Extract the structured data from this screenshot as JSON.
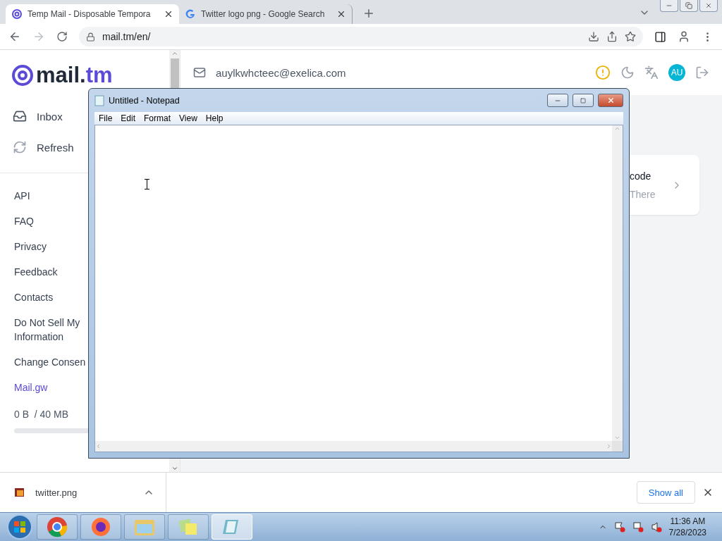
{
  "browser": {
    "tabs": [
      {
        "title": "Temp Mail - Disposable Tempora",
        "selected": true
      },
      {
        "title": "Twitter logo png - Google Search",
        "selected": false
      }
    ],
    "address": "mail.tm/en/"
  },
  "page": {
    "logo": {
      "main": "mail.",
      "accent": "tm"
    },
    "sidebar": {
      "actions": [
        {
          "label": "Inbox",
          "kind": "inbox"
        },
        {
          "label": "Refresh",
          "kind": "refresh"
        }
      ],
      "links": [
        {
          "label": "API",
          "kind": "plain"
        },
        {
          "label": "FAQ",
          "kind": "plain"
        },
        {
          "label": "Privacy",
          "kind": "plain"
        },
        {
          "label": "Feedback",
          "kind": "plain"
        },
        {
          "label": "Contacts",
          "kind": "plain"
        },
        {
          "label": "Do Not Sell My\nInformation",
          "kind": "plain"
        },
        {
          "label": "Change Consen",
          "kind": "plain"
        },
        {
          "label": "Mail.gw",
          "kind": "accent"
        }
      ],
      "storage": {
        "reading": "0 B  / 40 MB",
        "level": 0
      }
    },
    "header": {
      "email": "auylkwhcteec@exelica.com",
      "avatar": "AU"
    },
    "card": {
      "title": "code",
      "subtitle": "There"
    }
  },
  "notepad": {
    "title": "Untitled - Notepad",
    "menu": [
      "File",
      "Edit",
      "Format",
      "View",
      "Help"
    ]
  },
  "downloads": {
    "file": "twitter.png",
    "button": "Show all"
  },
  "taskbar": {
    "apps": [
      {
        "kind": "chrome",
        "active": false
      },
      {
        "kind": "firefox",
        "active": false
      },
      {
        "kind": "explorer",
        "active": false
      },
      {
        "kind": "notes",
        "active": false
      },
      {
        "kind": "notepad",
        "active": true
      }
    ],
    "time": "11:36 AM",
    "date": "7/28/2023"
  }
}
